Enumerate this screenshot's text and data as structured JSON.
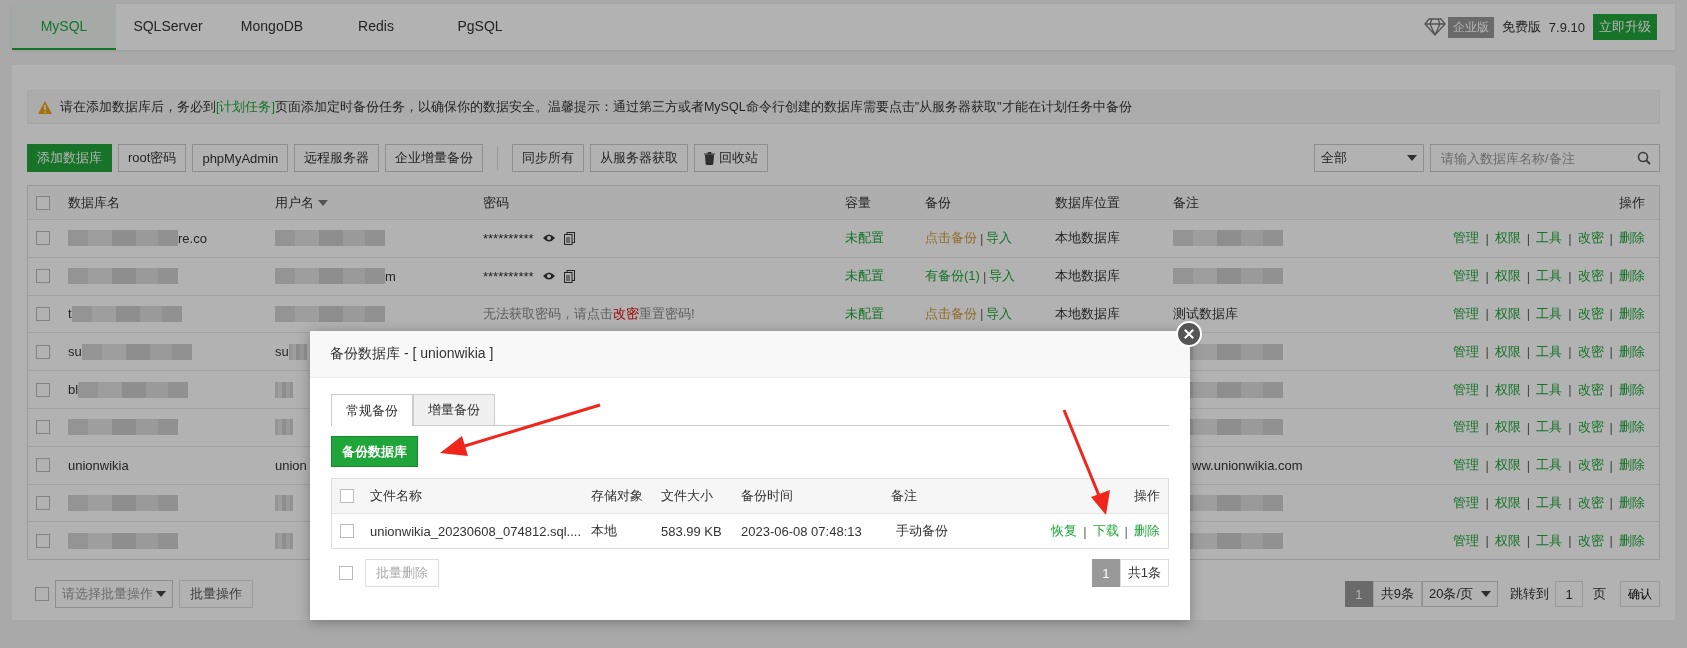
{
  "db_tabs": [
    {
      "label": "MySQL",
      "selected": true
    },
    {
      "label": "SQLServer",
      "selected": false
    },
    {
      "label": "MongoDB",
      "selected": false
    },
    {
      "label": "Redis",
      "selected": false
    },
    {
      "label": "PgSQL",
      "selected": false
    }
  ],
  "edition": {
    "badge": "企业版",
    "plan": "免费版",
    "version": "7.9.10",
    "upgrade": "立即升级"
  },
  "alert": {
    "before": "请在添加数据库后，务必到",
    "link": "[计划任务]",
    "after": "页面添加定时备份任务，以确保你的数据安全。温馨提示：通过第三方或者MySQL命令行创建的数据库需要点击\"从服务器获取\"才能在计划任务中备份"
  },
  "toolbar": [
    {
      "label": "添加数据库",
      "kind": "primary"
    },
    {
      "label": "root密码",
      "kind": "default"
    },
    {
      "label": "phpMyAdmin",
      "kind": "default"
    },
    {
      "label": "远程服务器",
      "kind": "default"
    },
    {
      "label": "企业增量备份",
      "kind": "default"
    },
    {
      "label": "同步所有",
      "kind": "grouped"
    },
    {
      "label": "从服务器获取",
      "kind": "default"
    },
    {
      "label": "回收站",
      "kind": "trash"
    }
  ],
  "filter": {
    "value": "全部"
  },
  "search": {
    "placeholder": "请输入数据库名称/备注"
  },
  "table": {
    "columns": [
      "数据库名",
      "用户名",
      "密码",
      "容量",
      "备份",
      "数据库位置",
      "备注",
      "操作"
    ],
    "separator": "|",
    "all_checked": false,
    "rows": [
      {
        "checked": false,
        "name": [
          {
            "kind": "blur"
          },
          {
            "kind": "text",
            "text": "re.co"
          }
        ],
        "user": [
          {
            "kind": "blur"
          }
        ],
        "password": {
          "kind": "hidden",
          "text": "**********"
        },
        "capacity": "未配置",
        "backup": {
          "label": "点击备份",
          "has_backup": false,
          "import": "导入"
        },
        "location": "本地数据库",
        "note": [
          {
            "kind": "blur"
          }
        ],
        "actions": [
          "管理",
          "权限",
          "工具",
          "改密",
          "删除"
        ]
      },
      {
        "checked": false,
        "name": [
          {
            "kind": "blur"
          }
        ],
        "user": [
          {
            "kind": "blur"
          },
          {
            "kind": "text",
            "text": "m"
          }
        ],
        "password": {
          "kind": "hidden",
          "text": "**********"
        },
        "capacity": "未配置",
        "backup": {
          "label": "有备份(1)",
          "has_backup": true,
          "import": "导入"
        },
        "location": "本地数据库",
        "note": [
          {
            "kind": "blur"
          }
        ],
        "actions": [
          "管理",
          "权限",
          "工具",
          "改密",
          "删除"
        ]
      },
      {
        "checked": false,
        "name": [
          {
            "kind": "text",
            "text": "t"
          },
          {
            "kind": "blur"
          }
        ],
        "user": [
          {
            "kind": "blur"
          }
        ],
        "password": {
          "kind": "message",
          "before": "无法获取密码，请点击",
          "link": "改密",
          "after": "重置密码!"
        },
        "capacity": "未配置",
        "backup": {
          "label": "点击备份",
          "has_backup": false,
          "import": "导入"
        },
        "location": "本地数据库",
        "note": [
          {
            "kind": "text",
            "text": "测试数据库"
          }
        ],
        "actions": [
          "管理",
          "权限",
          "工具",
          "改密",
          "删除"
        ]
      },
      {
        "checked": false,
        "name": [
          {
            "kind": "text",
            "text": "su"
          },
          {
            "kind": "blur"
          }
        ],
        "user": [
          {
            "kind": "text",
            "text": "su"
          },
          {
            "kind": "blur"
          }
        ],
        "note": [
          {
            "kind": "blur"
          }
        ],
        "actions": [
          "管理",
          "权限",
          "工具",
          "改密",
          "删除"
        ]
      },
      {
        "checked": false,
        "name": [
          {
            "kind": "text",
            "text": "bl"
          },
          {
            "kind": "blur"
          }
        ],
        "user": [
          {
            "kind": "blur"
          }
        ],
        "note": [
          {
            "kind": "blur"
          }
        ],
        "actions": [
          "管理",
          "权限",
          "工具",
          "改密",
          "删除"
        ]
      },
      {
        "checked": false,
        "name": [
          {
            "kind": "blur"
          }
        ],
        "user": [
          {
            "kind": "blur"
          }
        ],
        "note": [
          {
            "kind": "blur"
          }
        ],
        "actions": [
          "管理",
          "权限",
          "工具",
          "改密",
          "删除"
        ]
      },
      {
        "checked": false,
        "name": [
          {
            "kind": "text",
            "text": "unionwikia"
          }
        ],
        "user": [
          {
            "kind": "text",
            "text": "union"
          }
        ],
        "note": [
          {
            "kind": "covered"
          },
          {
            "kind": "text",
            "text": "ww.unionwikia.com"
          }
        ],
        "actions": [
          "管理",
          "权限",
          "工具",
          "改密",
          "删除"
        ]
      },
      {
        "checked": false,
        "name": [
          {
            "kind": "blur"
          }
        ],
        "user": [
          {
            "kind": "blur"
          }
        ],
        "note": [
          {
            "kind": "blur"
          }
        ],
        "actions": [
          "管理",
          "权限",
          "工具",
          "改密",
          "删除"
        ]
      },
      {
        "checked": false,
        "name": [
          {
            "kind": "blur"
          }
        ],
        "user": [
          {
            "kind": "blur"
          }
        ],
        "note": [
          {
            "kind": "blur"
          }
        ],
        "actions": [
          "管理",
          "权限",
          "工具",
          "改密",
          "删除"
        ]
      }
    ]
  },
  "batch": {
    "checked": false,
    "placeholder": "请选择批量操作",
    "button": "批量操作"
  },
  "pager": {
    "current": "1",
    "total": "共9条",
    "page_size": "20条/页",
    "jump_label": "跳转到",
    "jump_value": "1",
    "page_unit": "页",
    "confirm": "确认"
  },
  "modal": {
    "title": "备份数据库 - [ unionwikia ]",
    "tabs": [
      {
        "label": "常规备份",
        "selected": true
      },
      {
        "label": "增量备份",
        "selected": false
      }
    ],
    "backup_button": "备份数据库",
    "table": {
      "columns": [
        "文件名称",
        "存储对象",
        "文件大小",
        "备份时间",
        "备注",
        "操作"
      ],
      "separator": "|",
      "all_checked": false,
      "rows": [
        {
          "checked": false,
          "file": "unionwikia_20230608_074812.sql....",
          "storage": "本地",
          "size": "583.99 KB",
          "time": "2023-06-08 07:48:13",
          "note": "手动备份",
          "actions": [
            "恢复",
            "下载",
            "删除"
          ]
        }
      ]
    },
    "bulk_checked": false,
    "bulk_delete": "批量删除",
    "pager": {
      "current": "1",
      "total": "共1条"
    }
  }
}
